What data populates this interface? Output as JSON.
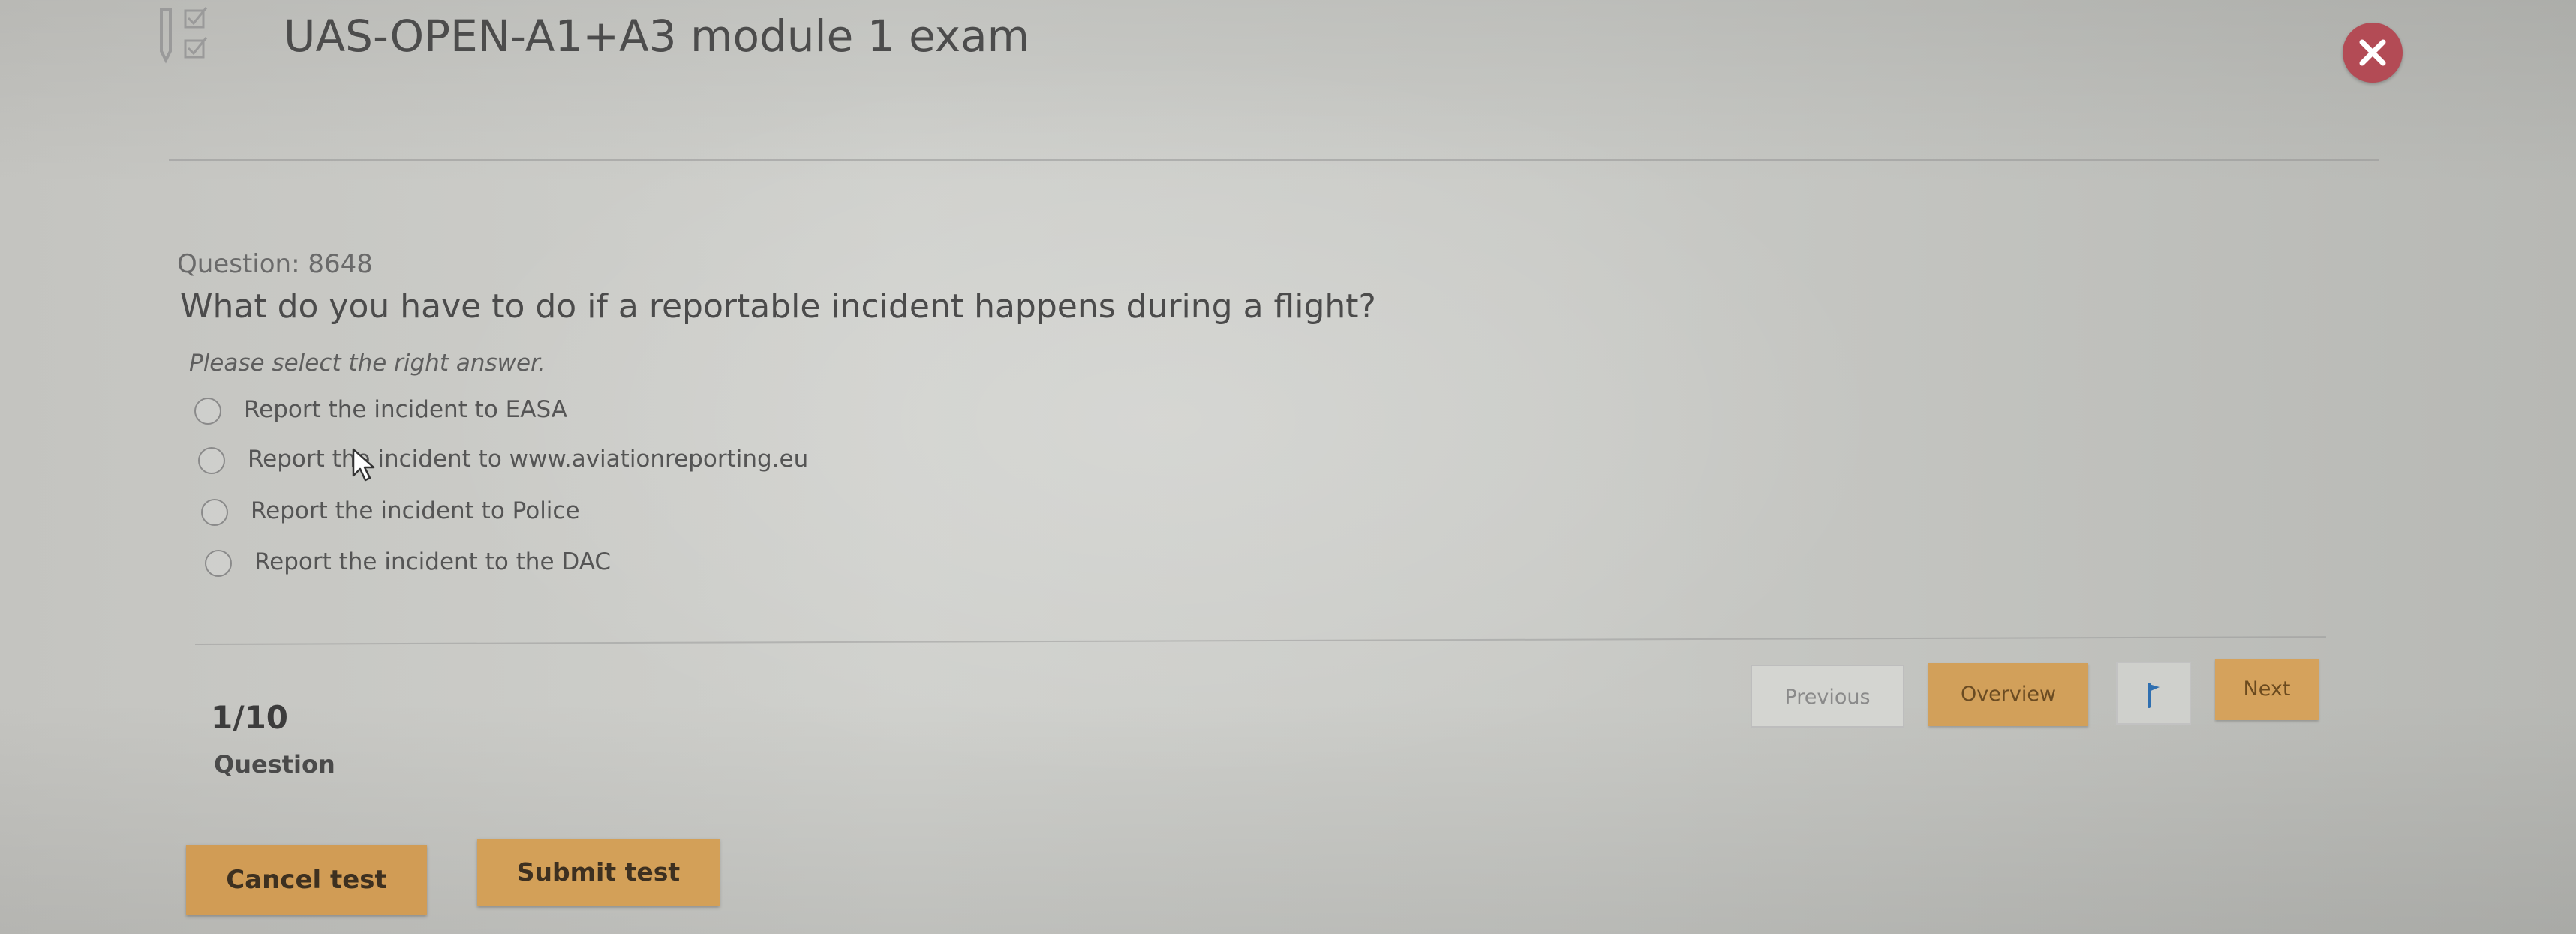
{
  "header": {
    "app_icon": "checklist-pencil-icon",
    "title": "UAS-OPEN-A1+A3 module 1 exam",
    "close_icon": "close-icon",
    "close_color": "#b34b55"
  },
  "question": {
    "number_label": "Question: 8648",
    "text": "What do you have to do if a reportable incident happens during a flight?",
    "instruction": "Please select the right answer.",
    "options": [
      {
        "label": "Report the incident to EASA",
        "selected": false
      },
      {
        "label": "Report the incident to www.aviationreporting.eu",
        "selected": false
      },
      {
        "label": "Report the incident to Police",
        "selected": false
      },
      {
        "label": "Report the incident to the DAC",
        "selected": false
      }
    ]
  },
  "progress": {
    "count": "1/10",
    "label": "Question"
  },
  "nav": {
    "previous": "Previous",
    "overview": "Overview",
    "flag_icon": "flag-icon",
    "next": "Next"
  },
  "actions": {
    "cancel": "Cancel test",
    "submit": "Submit test"
  },
  "colors": {
    "accent": "#d3a058",
    "close": "#b34b55"
  }
}
